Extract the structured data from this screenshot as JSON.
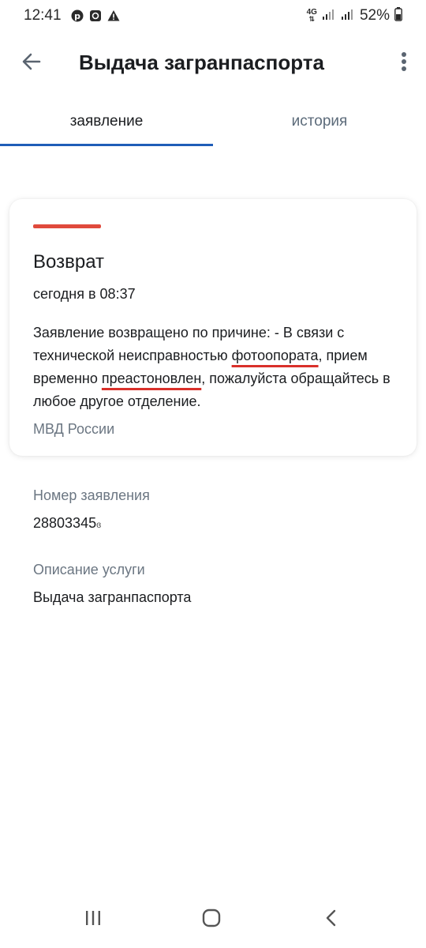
{
  "status_bar": {
    "time": "12:41",
    "network": "4G",
    "battery": "52%"
  },
  "header": {
    "title": "Выдача загранпаспорта"
  },
  "tabs": [
    {
      "label": "заявление",
      "active": true
    },
    {
      "label": "история",
      "active": false
    }
  ],
  "card": {
    "accent_color": "#e04a3c",
    "title": "Возврат",
    "date": "сегодня в 08:37",
    "text_part1": "Заявление возвращено по причине: - В связи с технической неисправностью ",
    "text_underlined1": "фотоопората",
    "text_part2": ", прием временно ",
    "text_underlined2": "преастоновлен",
    "text_part3": ", пожалуйста обращайтесь в любое другое отделение.",
    "source": "МВД России"
  },
  "details": {
    "application_number_label": "Номер заявления",
    "application_number": "28803345",
    "service_description_label": "Описание услуги",
    "service_description": "Выдача загранпаспорта"
  },
  "colors": {
    "tab_indicator": "#1f5db8",
    "underline": "#d9302a"
  }
}
